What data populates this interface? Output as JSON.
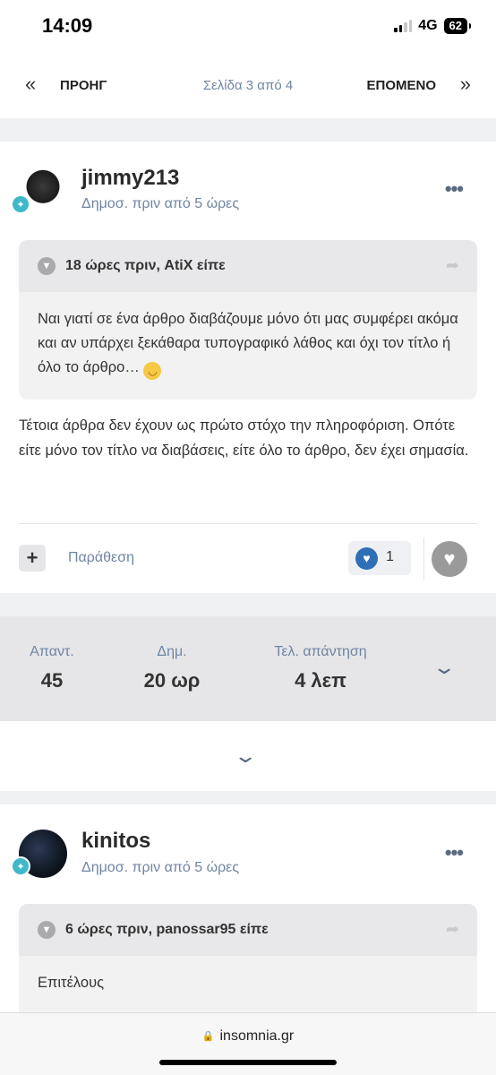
{
  "status_bar": {
    "time": "14:09",
    "network": "4G",
    "battery": "62"
  },
  "pagination": {
    "prev_label": "ΠΡΟΗΓ",
    "page_info": "Σελίδα 3 από 4",
    "next_label": "ΕΠΟΜΕΝΟ",
    "prev_icon": "«",
    "next_icon": "»"
  },
  "posts": [
    {
      "username": "jimmy213",
      "meta": "Δημοσ. πριν από 5 ώρες",
      "quote": {
        "header": "18 ώρες πριν, AtiX είπε",
        "body": "Ναι γιατί σε ένα άρθρο διαβάζουμε μόνο ότι μας συμφέρει ακόμα και αν υπάρχει ξεκάθαρα τυπογραφικό λάθος και όχι τον τίτλο ή όλο το άρθρο…"
      },
      "content": " Τέτοια άρθρα δεν έχουν ως πρώτο στόχο την πληροφόριση. Οπότε είτε μόνο τον τίτλο να διαβάσεις, είτε όλο το άρθρο, δεν έχει σημασία.",
      "quote_label": "Παράθεση",
      "reaction_count": "1"
    },
    {
      "username": "kinitos",
      "meta": "Δημοσ. πριν από 5 ώρες",
      "quote": {
        "header": "6 ώρες πριν, panossar95 είπε",
        "body": "Επιτέλους"
      }
    }
  ],
  "stats": [
    {
      "label": "Απαντ.",
      "value": "45"
    },
    {
      "label": "Δημ.",
      "value": "20 ωρ"
    },
    {
      "label": "Τελ. απάντηση",
      "value": "4 λεπ"
    }
  ],
  "browser": {
    "url": "insomnia.gr"
  },
  "icons": {
    "more": "more-horizontal-icon",
    "quote_collapse": "chevron-down-icon",
    "share": "share-icon",
    "reaction": "heart-icon",
    "like": "heart-icon",
    "expand": "chevron-down-icon"
  },
  "colors": {
    "accent": "#6f86a3",
    "reaction_blue": "#2f6fb6",
    "rank_badge": "#3fb8c9"
  }
}
